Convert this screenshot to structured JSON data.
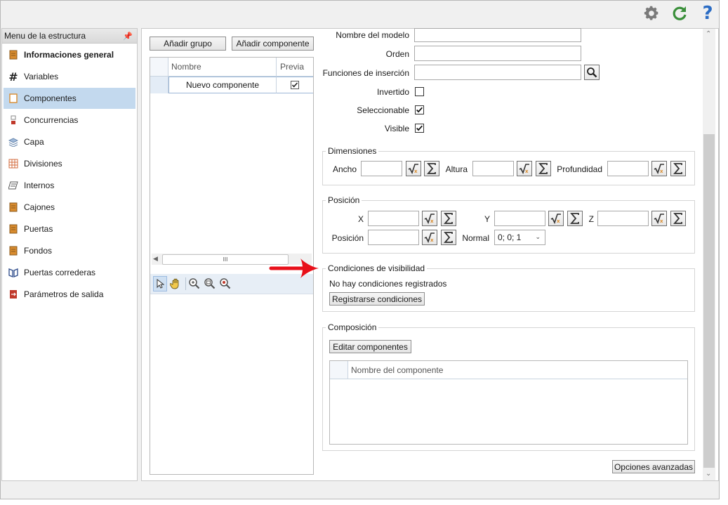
{
  "menu": {
    "title": "Menu de la estructura",
    "items": [
      {
        "label": "Informaciones general",
        "icon": "info-doc-icon",
        "color": "#d98c2f"
      },
      {
        "label": "Variables",
        "icon": "hash-icon",
        "color": "#222222"
      },
      {
        "label": "Componentes",
        "icon": "component-icon",
        "color": "#d98c2f"
      },
      {
        "label": "Concurrencias",
        "icon": "concurrency-icon",
        "color": "#c0392b"
      },
      {
        "label": "Capa",
        "icon": "layers-icon",
        "color": "#6a89b0"
      },
      {
        "label": "Divisiones",
        "icon": "grid-icon",
        "color": "#d36b3d"
      },
      {
        "label": "Internos",
        "icon": "internal-icon",
        "color": "#555555"
      },
      {
        "label": "Cajones",
        "icon": "drawers-icon",
        "color": "#d98c2f"
      },
      {
        "label": "Puertas",
        "icon": "door-icon",
        "color": "#d98c2f"
      },
      {
        "label": "Fondos",
        "icon": "back-panel-icon",
        "color": "#d98c2f"
      },
      {
        "label": "Puertas correderas",
        "icon": "sliding-door-icon",
        "color": "#2c4a8a"
      },
      {
        "label": "Parámetros de salida",
        "icon": "output-icon",
        "color": "#c0392b"
      }
    ]
  },
  "toolbar": {
    "add_group": "Añadir grupo",
    "add_component": "Añadir componente"
  },
  "grid": {
    "columns": {
      "name": "Nombre",
      "preview": "Previa"
    },
    "rows": [
      {
        "name": "Nuevo componente",
        "preview": true
      }
    ],
    "hscroll_thumb": "III"
  },
  "form": {
    "model_name_label": "Nombre del modelo",
    "order_label": "Orden",
    "insert_functions_label": "Funciones de inserción",
    "inverted_label": "Invertido",
    "inverted": false,
    "selectable_label": "Seleccionable",
    "selectable": true,
    "visible_label": "Visible",
    "visible": true
  },
  "dimensions": {
    "title": "Dimensiones",
    "width_label": "Ancho",
    "height_label": "Altura",
    "depth_label": "Profundidad"
  },
  "position": {
    "title": "Posición",
    "x_label": "X",
    "y_label": "Y",
    "z_label": "Z",
    "position_label": "Posición",
    "normal_label": "Normal",
    "normal_value": "0; 0; 1"
  },
  "visibility": {
    "title": "Condiciones de visibilidad",
    "empty_text": "No hay condiciones registrados",
    "register_button": "Registrarse condiciones"
  },
  "composition": {
    "title": "Composición",
    "edit_button": "Editar componentes",
    "column_name": "Nombre del componente"
  },
  "advanced_button": "Opciones avanzadas",
  "colors": {
    "selected_menu": "#c3d9ee",
    "accent_green": "#3a8f3a",
    "accent_blue": "#2b6cc4",
    "arrow_red": "#e8101a"
  }
}
